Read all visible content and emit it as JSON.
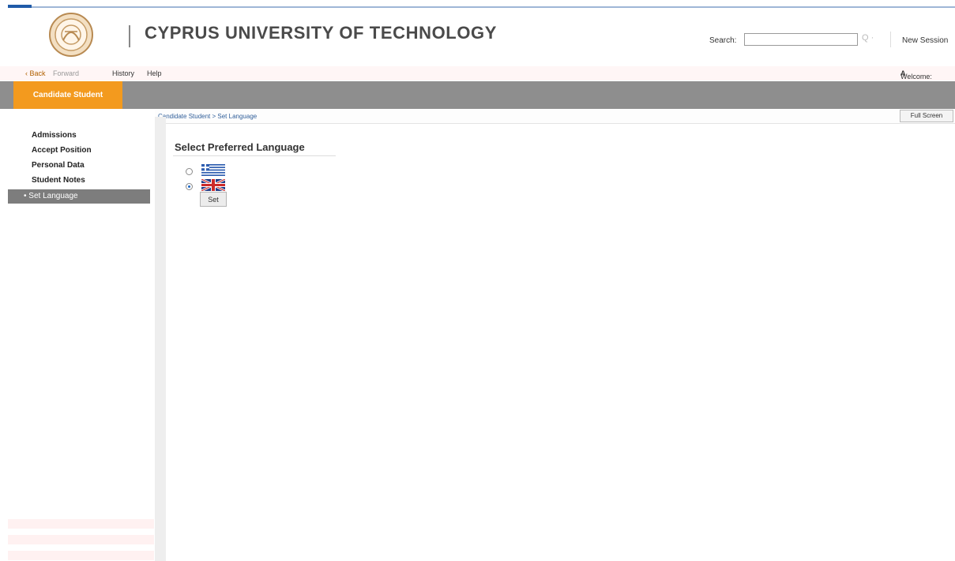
{
  "header": {
    "title": "CYPRUS UNIVERSITY OF TECHNOLOGY",
    "search_label": "Search:",
    "search_value": "",
    "search_go": "Q ·",
    "new_session": "New Session"
  },
  "navbar": {
    "back": "‹ Back",
    "forward": "Forward",
    "history": "History",
    "help": "Help",
    "welcome": "Welcome: ",
    "welcome_user": "A"
  },
  "tabs": {
    "active": "Candidate Student"
  },
  "sidebar": {
    "items": [
      {
        "label": "Admissions"
      },
      {
        "label": "Accept Position"
      },
      {
        "label": "Personal Data"
      },
      {
        "label": "Student Notes"
      }
    ],
    "active_item": "Set Language"
  },
  "breadcrumb": "Candidate Student  >  Set Language",
  "fullscreen_label": "Full Screen",
  "page": {
    "title": "Select Preferred Language",
    "options": [
      {
        "flag": "greek-flag-icon",
        "selected": false
      },
      {
        "flag": "uk-flag-icon",
        "selected": true
      }
    ],
    "set_label": "Set"
  },
  "colors": {
    "accent_orange": "#f39a1e",
    "bar_grey": "#8e8e8e",
    "link_blue": "#315f9a"
  }
}
